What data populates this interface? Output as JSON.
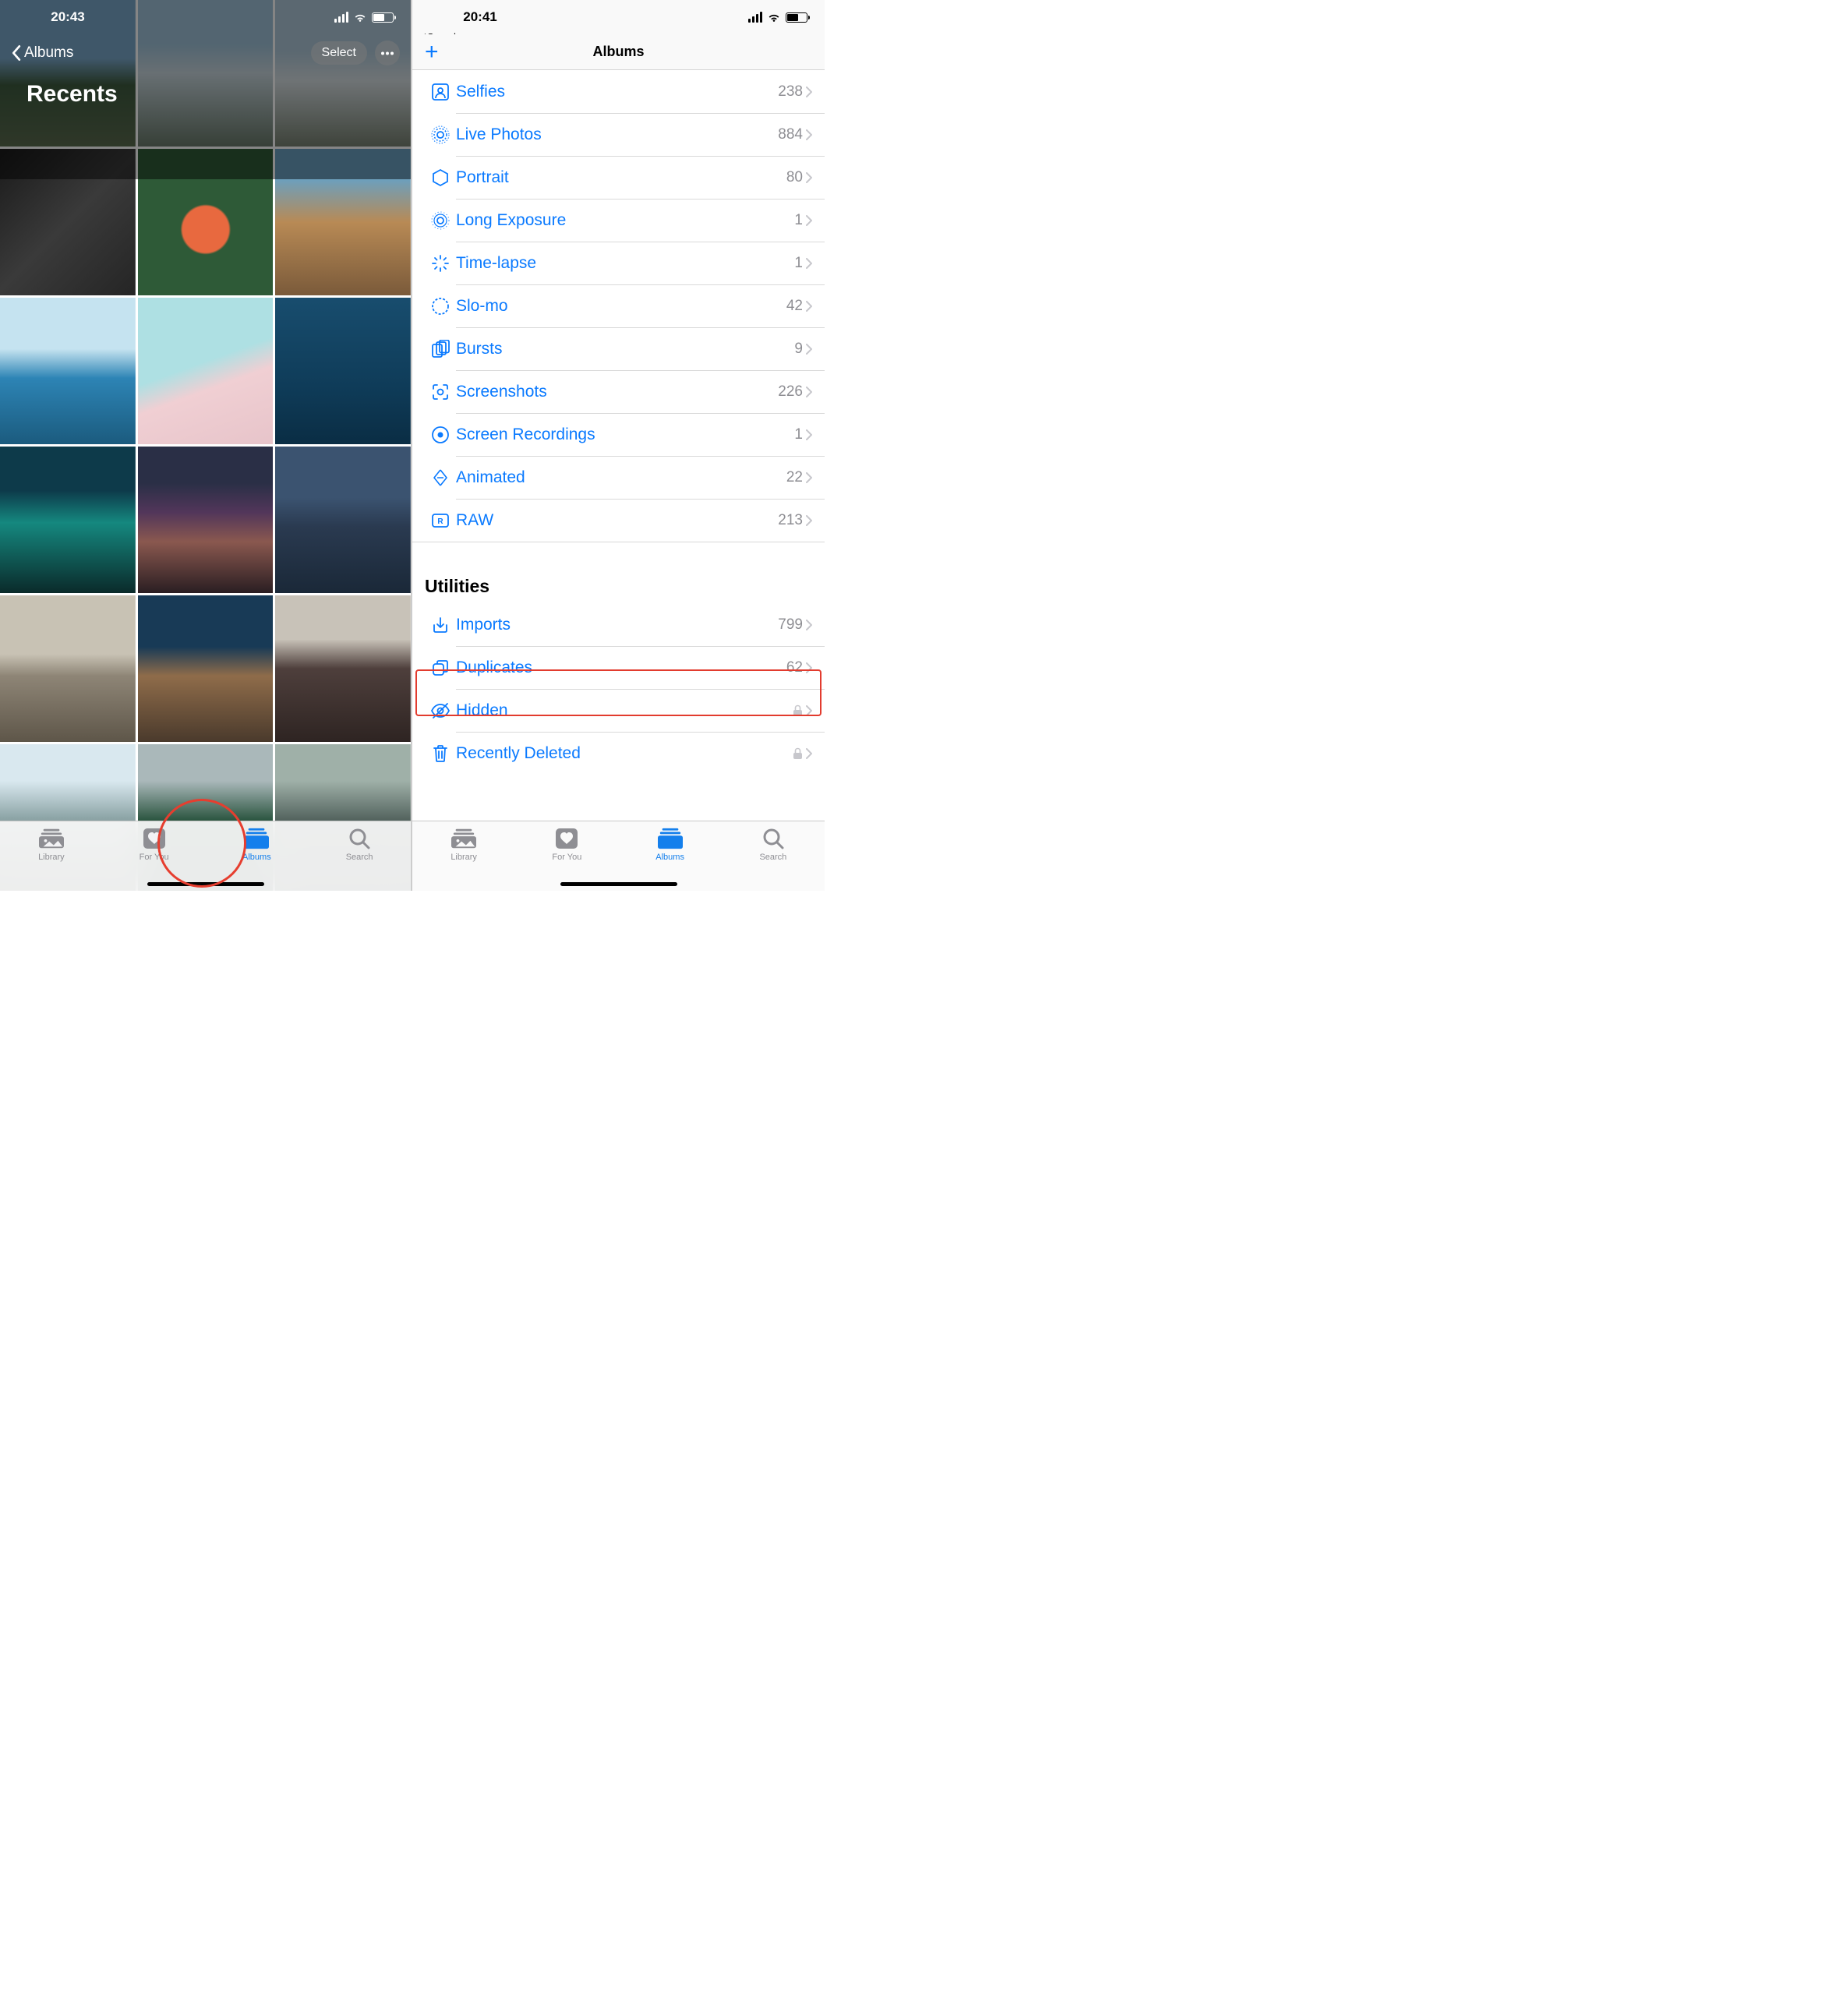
{
  "left": {
    "status_time": "20:43",
    "nav_back_label": "Albums",
    "select_label": "Select",
    "page_title": "Recents",
    "tabs": [
      {
        "label": "Library"
      },
      {
        "label": "For You"
      },
      {
        "label": "Albums"
      },
      {
        "label": "Search"
      }
    ]
  },
  "right": {
    "status_time": "20:41",
    "breadcrumb": "Search",
    "nav_title": "Albums",
    "media_types": [
      {
        "label": "Selfies",
        "count": "238"
      },
      {
        "label": "Live Photos",
        "count": "884"
      },
      {
        "label": "Portrait",
        "count": "80"
      },
      {
        "label": "Long Exposure",
        "count": "1"
      },
      {
        "label": "Time-lapse",
        "count": "1"
      },
      {
        "label": "Slo-mo",
        "count": "42"
      },
      {
        "label": "Bursts",
        "count": "9"
      },
      {
        "label": "Screenshots",
        "count": "226"
      },
      {
        "label": "Screen Recordings",
        "count": "1"
      },
      {
        "label": "Animated",
        "count": "22"
      },
      {
        "label": "RAW",
        "count": "213"
      }
    ],
    "utilities_title": "Utilities",
    "utilities": [
      {
        "label": "Imports",
        "count": "799"
      },
      {
        "label": "Duplicates",
        "count": "62"
      },
      {
        "label": "Hidden",
        "lock": true
      },
      {
        "label": "Recently Deleted",
        "lock": true
      }
    ],
    "tabs": [
      {
        "label": "Library"
      },
      {
        "label": "For You"
      },
      {
        "label": "Albums"
      },
      {
        "label": "Search"
      }
    ]
  }
}
